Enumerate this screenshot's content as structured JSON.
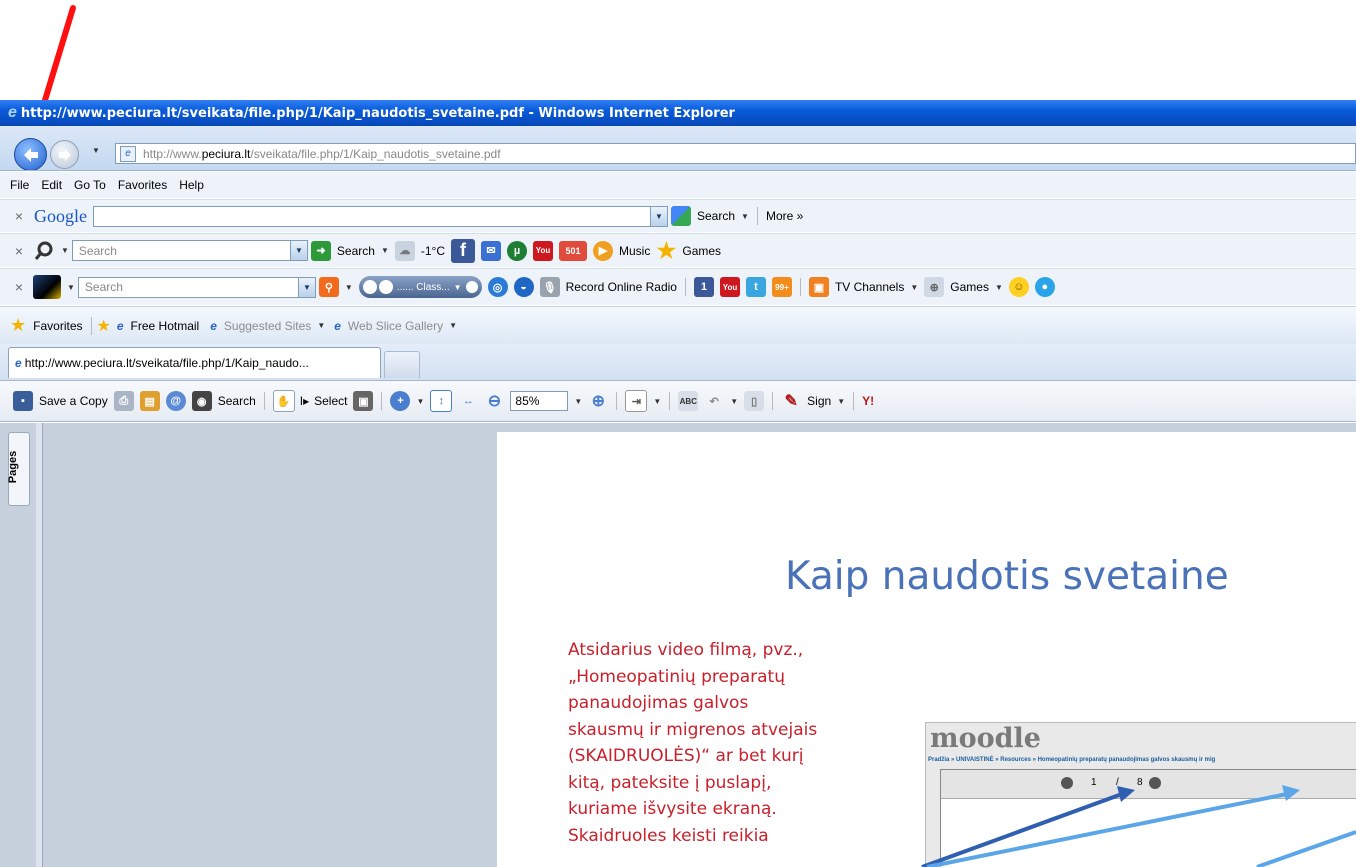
{
  "title_bar": {
    "text": "http://www.peciura.lt/sveikata/file.php/1/Kaip_naudotis_svetaine.pdf - Windows Internet Explorer"
  },
  "address": {
    "pre": "http://www.",
    "domain": "peciura.lt",
    "post": "/sveikata/file.php/1/Kaip_naudotis_svetaine.pdf"
  },
  "menu": {
    "items": [
      "File",
      "Edit",
      "Go To",
      "Favorites",
      "Help"
    ]
  },
  "google_bar": {
    "logo": "Google",
    "search_label": "Search",
    "more_label": "More »"
  },
  "search_bar2": {
    "placeholder": "Search",
    "search_label": "Search",
    "temperature": "-1°C",
    "count_badge": "501",
    "music_label": "Music",
    "games_label": "Games"
  },
  "search_bar3": {
    "placeholder": "Search",
    "class_label": "...... Class...",
    "record_label": "Record Online Radio",
    "facebook_badge": "1",
    "rss_badge": "99+",
    "tv_label": "TV Channels",
    "games_label": "Games"
  },
  "favorites_bar": {
    "favorites_label": "Favorites",
    "hotmail_label": "Free Hotmail",
    "suggested_label": "Suggested Sites",
    "webslice_label": "Web Slice Gallery"
  },
  "tab": {
    "label": "http://www.peciura.lt/sveikata/file.php/1/Kaip_naudo..."
  },
  "pdf_toolbar": {
    "save_label": "Save a Copy",
    "search_label": "Search",
    "select_label": "Select",
    "zoom_value": "85%",
    "sign_label": "Sign",
    "brand": "Y!"
  },
  "side_panel": {
    "pages_tab": "Pages"
  },
  "document": {
    "heading": "Kaip naudotis svetaine",
    "paragraph_lines": [
      "Atsidarius video filmą, pvz.,",
      "„Homeopatinių preparatų",
      "panaudojimas galvos",
      "skausmų ir migrenos atvejais",
      "(SKAIDRUOLĖS)“ ar bet kurį",
      "kitą, pateksite į puslapį,",
      "kuriame išvysite ekraną.",
      "Skaidruoles keisti reikia"
    ],
    "moodle": {
      "logo": "moodle",
      "breadcrumb": "Pradžia » UNIVAISTINĖ » Resources » Homeopatinių preparatų panaudojimas galvos skausmų ir mig",
      "page_current": "1",
      "page_sep": "/",
      "page_total": "8"
    }
  },
  "colors": {
    "title_bar": "#0a5bd9",
    "doc_heading": "#4a72b8",
    "doc_text": "#c8202b",
    "annotation_arrow": "#ff1010"
  },
  "icons": [
    "ie-logo",
    "back-arrow-icon",
    "forward-arrow-icon",
    "search-icon",
    "facebook-icon",
    "youtube-icon",
    "mail-icon",
    "star-icon",
    "hand-tool-icon",
    "zoom-in-icon",
    "print-icon"
  ]
}
